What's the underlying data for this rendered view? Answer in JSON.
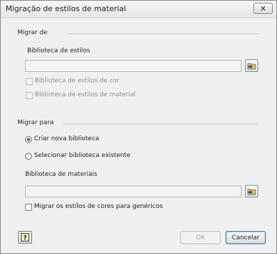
{
  "window": {
    "title": "Migração de estilos de material",
    "close_glyph": "✕"
  },
  "migrate_from": {
    "section_label": "Migrar de",
    "field_label": "Biblioteca de estilos",
    "value": "",
    "checkboxes": [
      {
        "label": "Biblioteca de estilos de cor",
        "checked": false,
        "enabled": false
      },
      {
        "label": "Biblioteca de estilos de material",
        "checked": false,
        "enabled": false
      }
    ]
  },
  "migrate_to": {
    "section_label": "Migrar para",
    "options": [
      {
        "label": "Criar nova biblioteca",
        "selected": true
      },
      {
        "label": "Selecionar biblioteca existente",
        "selected": false
      }
    ],
    "field_label": "Biblioteca de materiais",
    "value": "",
    "generic_checkbox": {
      "label": "Migrar os estilos de cores para genéricos",
      "checked": false,
      "enabled": true
    }
  },
  "footer": {
    "help_icon": "help-icon",
    "ok_label": "OK",
    "cancel_label": "Cancelar"
  },
  "colors": {
    "accent": "#1e5aa8"
  }
}
